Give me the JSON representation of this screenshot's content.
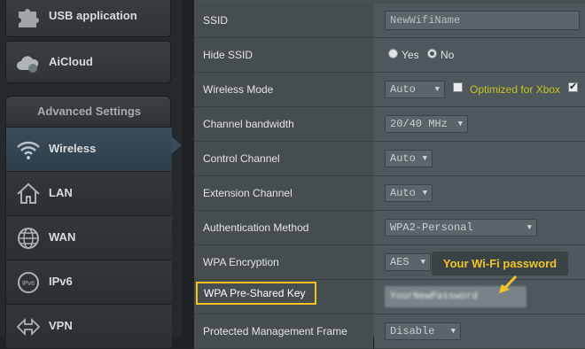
{
  "sidebar": {
    "top_items": [
      {
        "label": "USB application",
        "icon": "puzzle-icon"
      },
      {
        "label": "AiCloud",
        "icon": "cloud-icon"
      }
    ],
    "advanced_title": "Advanced Settings",
    "advanced_items": [
      {
        "label": "Wireless",
        "icon": "wifi-icon",
        "active": true
      },
      {
        "label": "LAN",
        "icon": "home-icon"
      },
      {
        "label": "WAN",
        "icon": "globe-icon"
      },
      {
        "label": "IPv6",
        "icon": "ipv6-icon"
      },
      {
        "label": "VPN",
        "icon": "vpn-icon"
      }
    ]
  },
  "settings": {
    "ssid": {
      "label": "SSID",
      "value": "NewWifiName"
    },
    "hide_ssid": {
      "label": "Hide SSID",
      "options": [
        "Yes",
        "No"
      ],
      "selected": "No"
    },
    "wireless_mode": {
      "label": "Wireless Mode",
      "value": "Auto",
      "xbox_label": "Optimized for Xbox",
      "xbox_checked": false,
      "extra_checked": true
    },
    "channel_bandwidth": {
      "label": "Channel bandwidth",
      "value": "20/40 MHz"
    },
    "control_channel": {
      "label": "Control Channel",
      "value": "Auto"
    },
    "extension_channel": {
      "label": "Extension Channel",
      "value": "Auto"
    },
    "auth_method": {
      "label": "Authentication Method",
      "value": "WPA2-Personal"
    },
    "wpa_encryption": {
      "label": "WPA Encryption",
      "value": "AES"
    },
    "wpa_psk": {
      "label": "WPA Pre-Shared Key",
      "value": "YourNewPassword"
    },
    "pmf": {
      "label": "Protected Management Frame",
      "value": "Disable"
    }
  },
  "annotation": {
    "callout_text": "Your Wi-Fi  password",
    "highlight_color": "#f1c21b"
  }
}
